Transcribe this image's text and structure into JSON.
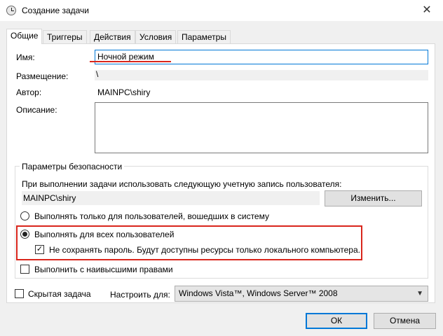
{
  "window": {
    "title": "Создание задачи",
    "close_label": "✕"
  },
  "tabs": [
    {
      "label": "Общие",
      "active": true
    },
    {
      "label": "Триггеры",
      "active": false
    },
    {
      "label": "Действия",
      "active": false
    },
    {
      "label": "Условия",
      "active": false
    },
    {
      "label": "Параметры",
      "active": false
    }
  ],
  "general": {
    "name_label": "Имя:",
    "name_value": "Ночной режим",
    "location_label": "Размещение:",
    "location_value": "\\",
    "author_label": "Автор:",
    "author_value": "MAINPC\\shiry",
    "description_label": "Описание:"
  },
  "security": {
    "legend": "Параметры безопасности",
    "run_as_text": "При выполнении задачи использовать следующую учетную запись пользователя:",
    "account_value": "MAINPC\\shiry",
    "change_button": "Изменить...",
    "radio_logged_on": "Выполнять только для пользователей, вошедших в систему",
    "radio_all_users": "Выполнять для всех пользователей",
    "checkbox_no_password": "Не сохранять пароль. Будут доступны ресурсы только локального компьютера.",
    "checkbox_highest": "Выполнить с наивысшими правами",
    "selected_radio": "all_users",
    "no_password_checked": true,
    "highest_checked": false
  },
  "bottom": {
    "hidden_label": "Скрытая задача",
    "hidden_checked": false,
    "configure_label": "Настроить для:",
    "configure_value": "Windows Vista™, Windows Server™ 2008",
    "ok_button": "ОК",
    "cancel_button": "Отмена"
  },
  "colors": {
    "accent": "#0078d7",
    "highlight_red": "#d9261c"
  }
}
